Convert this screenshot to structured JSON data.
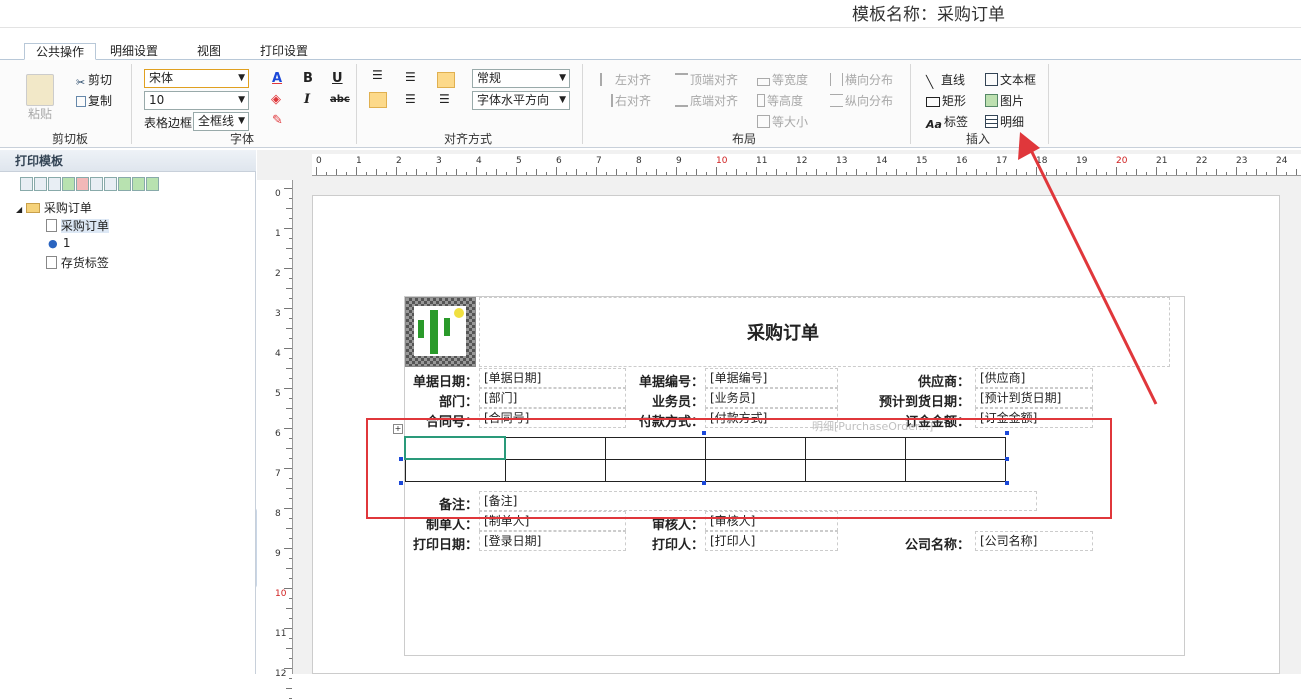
{
  "header": {
    "template_name": "模板名称：采购订单"
  },
  "tabs": [
    "公共操作",
    "明细设置",
    "视图",
    "打印设置"
  ],
  "ribbon": {
    "clipboard": {
      "paste": "粘贴",
      "cut": "剪切",
      "copy": "复制",
      "group_label": "剪切板"
    },
    "font": {
      "family": "宋体",
      "size": "10",
      "table_border_label": "表格边框",
      "table_border_value": "全框线",
      "group_label": "字体"
    },
    "align": {
      "style": "常规",
      "direction": "字体水平方向",
      "group_label": "对齐方式"
    },
    "layout": {
      "left_align": "左对齐",
      "right_align": "右对齐",
      "top_align": "顶端对齐",
      "bottom_align": "底端对齐",
      "equal_width": "等宽度",
      "equal_height": "等高度",
      "equal_size": "等大小",
      "h_distribute": "横向分布",
      "v_distribute": "纵向分布",
      "group_label": "布局"
    },
    "insert": {
      "line": "直线",
      "rect": "矩形",
      "label": "标签",
      "textbox": "文本框",
      "image": "图片",
      "detail": "明细",
      "group_label": "插入"
    }
  },
  "left_panel": {
    "title": "打印模板",
    "tree": [
      {
        "label": "采购订单",
        "level": 0,
        "type": "folder"
      },
      {
        "label": "采购订单",
        "level": 1,
        "type": "doc",
        "selected": true
      },
      {
        "label": "1",
        "level": 1,
        "type": "user"
      },
      {
        "label": "存货标签",
        "level": 1,
        "type": "doc"
      }
    ]
  },
  "ruler": {
    "h": [
      "0",
      "1",
      "2",
      "3",
      "4",
      "5",
      "6",
      "7",
      "8",
      "9",
      "10",
      "11",
      "12",
      "13",
      "14",
      "15",
      "16",
      "17",
      "18",
      "19",
      "20",
      "21",
      "22",
      "23",
      "24"
    ],
    "v": [
      "0",
      "1",
      "2",
      "3",
      "4",
      "5",
      "6",
      "7",
      "8",
      "9",
      "10",
      "11",
      "12"
    ]
  },
  "form": {
    "title": "采购订单",
    "fields": {
      "date_label": "单据日期：",
      "date_val": "[单据日期]",
      "no_label": "单据编号：",
      "no_val": "[单据编号]",
      "vendor_label": "供应商：",
      "vendor_val": "[供应商]",
      "dept_label": "部门：",
      "dept_val": "[部门]",
      "staff_label": "业务员：",
      "staff_val": "[业务员]",
      "arrival_label": "预计到货日期：",
      "arrival_val": "[预计到货日期]",
      "contract_label": "合同号：",
      "contract_val": "[合同号]",
      "payment_label": "付款方式：",
      "payment_val": "[付款方式]",
      "amount_label": "订金金额：",
      "amount_val": "[订金金额]",
      "remark_label": "备注：",
      "remark_val": "[备注]",
      "maker_label": "制单人：",
      "maker_val": "[制单人]",
      "auditor_label": "审核人：",
      "auditor_val": "[审核人]",
      "printdate_label": "打印日期：",
      "printdate_val": "[登录日期]",
      "printer_label": "打印人：",
      "printer_val": "[打印人]",
      "company_label": "公司名称：",
      "company_val": "[公司名称]"
    },
    "detail_caption": "明细[PurchaseOrder...]"
  },
  "colors": {
    "annotation": "#e0373b",
    "accent": "#1b48d8"
  }
}
